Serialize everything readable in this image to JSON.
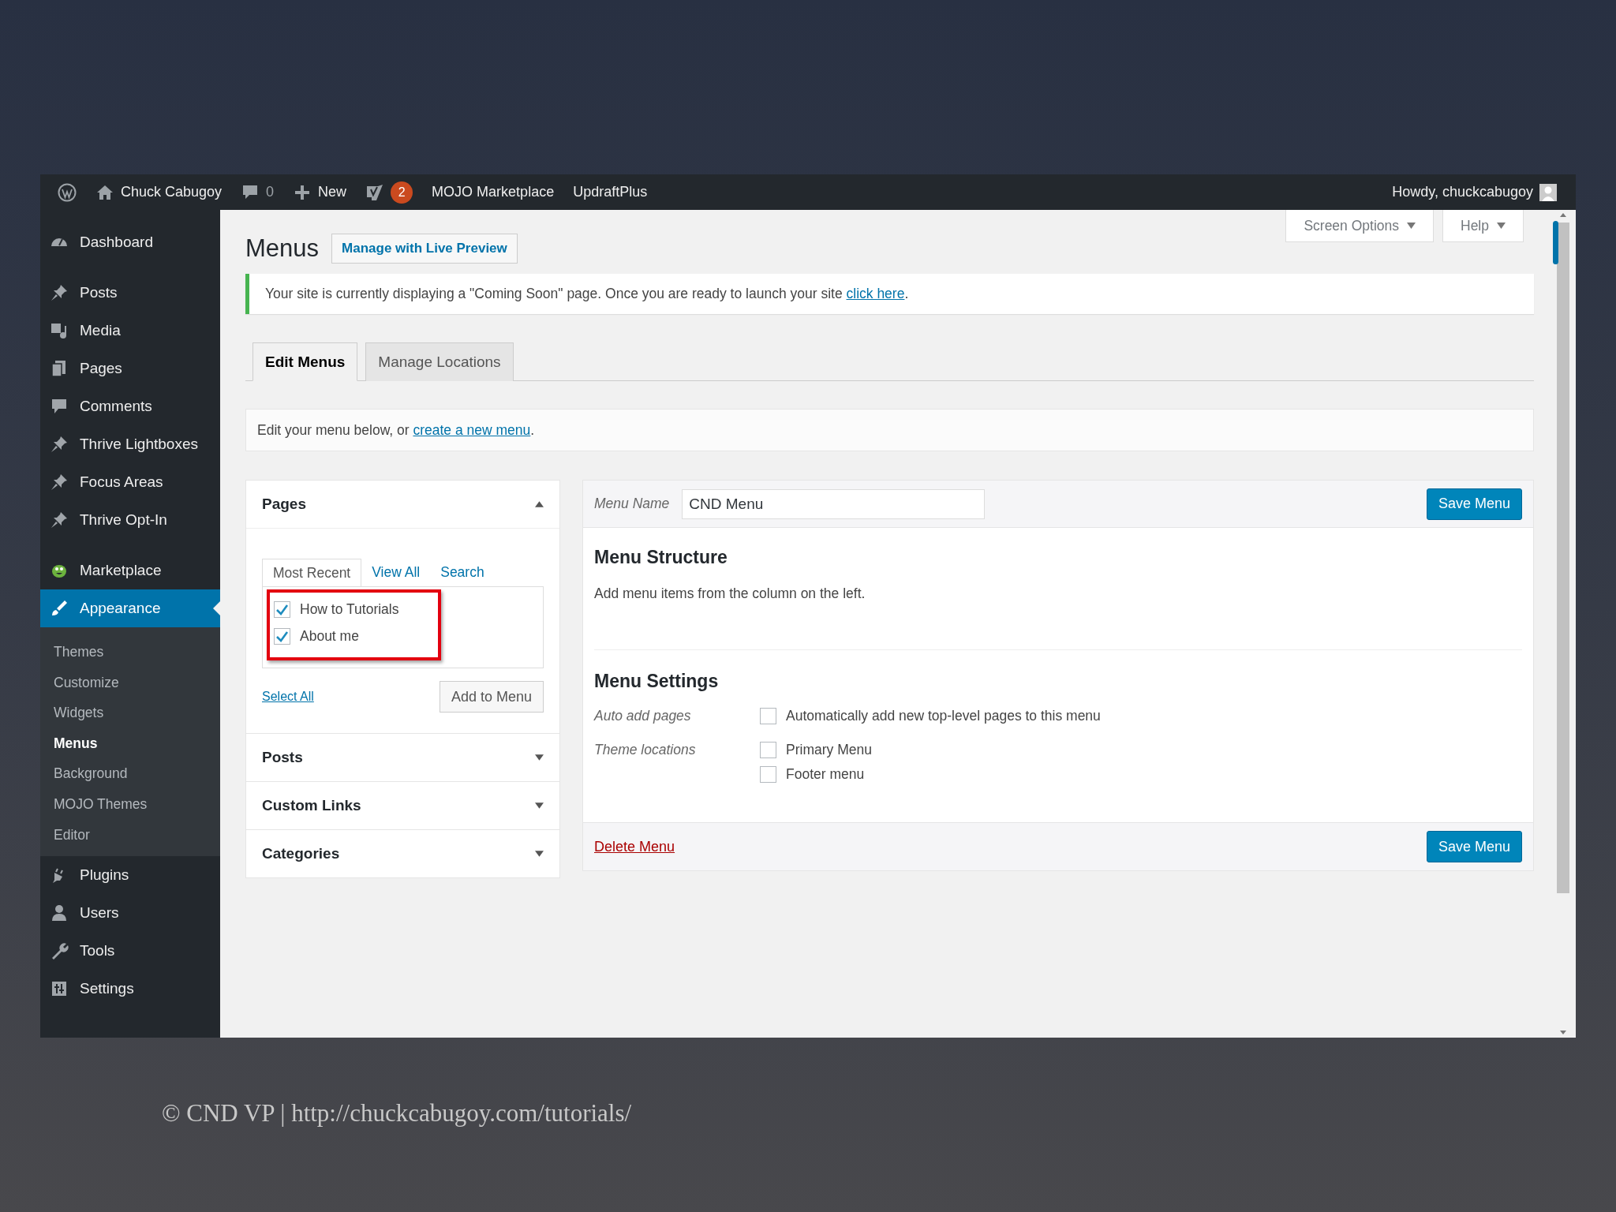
{
  "admin_bar": {
    "site": "Chuck Cabugoy",
    "comments": "0",
    "new": "New",
    "notifications": "2",
    "links": [
      "MOJO Marketplace",
      "UpdraftPlus"
    ],
    "greeting": "Howdy, chuckcabugoy"
  },
  "sidebar": {
    "groups": [
      [
        {
          "label": "Dashboard",
          "selected": false
        }
      ],
      [
        {
          "label": "Posts",
          "selected": false
        },
        {
          "label": "Media",
          "selected": false
        },
        {
          "label": "Pages",
          "selected": false
        },
        {
          "label": "Comments",
          "selected": false
        },
        {
          "label": "Thrive Lightboxes",
          "selected": false
        },
        {
          "label": "Focus Areas",
          "selected": false
        },
        {
          "label": "Thrive Opt-In",
          "selected": false
        }
      ],
      [
        {
          "label": "Marketplace",
          "selected": false
        },
        {
          "label": "Appearance",
          "selected": true,
          "children": [
            {
              "label": "Themes",
              "selected": false
            },
            {
              "label": "Customize",
              "selected": false
            },
            {
              "label": "Widgets",
              "selected": false
            },
            {
              "label": "Menus",
              "selected": true
            },
            {
              "label": "Background",
              "selected": false
            },
            {
              "label": "MOJO Themes",
              "selected": false
            },
            {
              "label": "Editor",
              "selected": false
            }
          ]
        },
        {
          "label": "Plugins",
          "selected": false
        },
        {
          "label": "Users",
          "selected": false
        },
        {
          "label": "Tools",
          "selected": false
        },
        {
          "label": "Settings",
          "selected": false
        }
      ]
    ]
  },
  "screen_meta": [
    "Screen Options",
    "Help"
  ],
  "page_title": "Menus",
  "title_action": "Manage with Live Preview",
  "notice": {
    "text": "Your site is currently displaying a \"Coming Soon\" page. Once you are ready to launch your site ",
    "link": "click here",
    "after": "."
  },
  "tabs": [
    {
      "label": "Edit Menus",
      "selected": true
    },
    {
      "label": "Manage Locations",
      "selected": false
    }
  ],
  "edit_prompt": {
    "text": "Edit your menu below, or ",
    "link": "create a new menu",
    "after": "."
  },
  "left_panels": [
    {
      "title": "Pages",
      "expanded": true,
      "tabs": [
        {
          "label": "Most Recent",
          "selected": true
        },
        {
          "label": "View All",
          "selected": false
        },
        {
          "label": "Search",
          "selected": false
        }
      ],
      "highlighted": true,
      "items": [
        {
          "label": "How to Tutorials",
          "checked": true
        },
        {
          "label": "About me",
          "checked": true
        }
      ],
      "select_all": "Select All",
      "button": "Add to Menu"
    },
    {
      "title": "Posts",
      "expanded": false
    },
    {
      "title": "Custom Links",
      "expanded": false
    },
    {
      "title": "Categories",
      "expanded": false
    }
  ],
  "menu_editor": {
    "name_label": "Menu Name",
    "name_value": "CND Menu",
    "save": "Save Menu",
    "structure_title": "Menu Structure",
    "structure_hint": "Add menu items from the column on the left.",
    "settings_title": "Menu Settings",
    "settings": [
      {
        "label": "Auto add pages",
        "options": [
          {
            "label": "Automatically add new top-level pages to this menu",
            "checked": false
          }
        ]
      },
      {
        "label": "Theme locations",
        "options": [
          {
            "label": "Primary Menu",
            "checked": false
          },
          {
            "label": "Footer menu",
            "checked": false
          }
        ]
      }
    ],
    "delete": "Delete Menu",
    "save_bottom": "Save Menu"
  },
  "caption": "© CND VP | http://chuckcabugoy.com/tutorials/"
}
